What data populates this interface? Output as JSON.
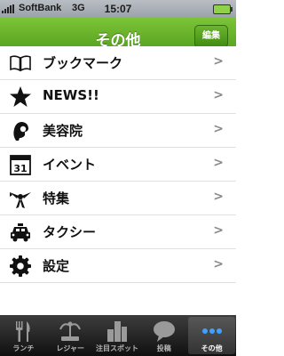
{
  "status_bar": {
    "carrier": "SoftBank",
    "network": "3G",
    "time": "15:07"
  },
  "nav": {
    "title": "その他",
    "edit_label": "編集"
  },
  "menu": [
    {
      "label": "ブックマーク",
      "icon": "book-icon"
    },
    {
      "label": "NEWS!!",
      "icon": "star-icon"
    },
    {
      "label": "美容院",
      "icon": "hair-salon-icon"
    },
    {
      "label": "イベント",
      "icon": "calendar-icon",
      "icon_text": "31"
    },
    {
      "label": "特集",
      "icon": "ribbon-icon"
    },
    {
      "label": "タクシー",
      "icon": "taxi-icon"
    },
    {
      "label": "設定",
      "icon": "gear-icon"
    }
  ],
  "chevron": ">",
  "tabs": [
    {
      "label": "ランチ",
      "icon": "fork-knife-icon"
    },
    {
      "label": "レジャー",
      "icon": "fountain-icon"
    },
    {
      "label": "注目スポット",
      "icon": "buildings-icon"
    },
    {
      "label": "投稿",
      "icon": "speech-bubble-icon"
    },
    {
      "label": "その他",
      "icon": "more-dots-icon",
      "selected": true
    }
  ],
  "colors": {
    "nav_green": "#5fae24",
    "active_tab_dots": "#3fa0ff"
  }
}
